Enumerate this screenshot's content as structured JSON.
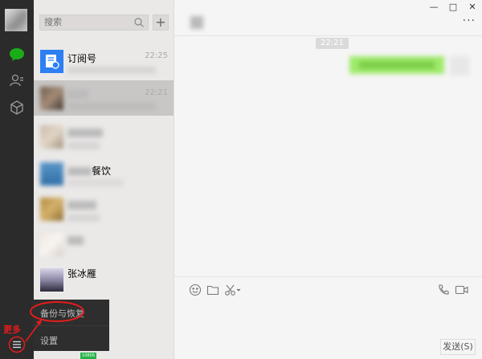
{
  "search": {
    "placeholder": "搜索"
  },
  "add_label": "+",
  "conversations": [
    {
      "name": "订阅号",
      "time": "22:25"
    },
    {
      "name": "",
      "time": "22:21"
    },
    {
      "name": "",
      "time": ""
    },
    {
      "name": "餐饮",
      "time": ""
    },
    {
      "name": "",
      "time": ""
    },
    {
      "name": "",
      "time": ""
    },
    {
      "name": "张冰雁",
      "time": ""
    }
  ],
  "chat": {
    "timestamp": "22:21",
    "more": "···"
  },
  "window_controls": {
    "minimize": "—",
    "maximize": "□",
    "close": "✕"
  },
  "send_button": "发送(S)",
  "popup_menu": {
    "backup": "备份与恢复",
    "settings": "设置"
  },
  "annotation": {
    "more": "更多"
  },
  "promo_badge": "1080S",
  "colors": {
    "accent": "#1aad19",
    "annotation": "#e51c1c",
    "bubble": "#9eea6a"
  }
}
